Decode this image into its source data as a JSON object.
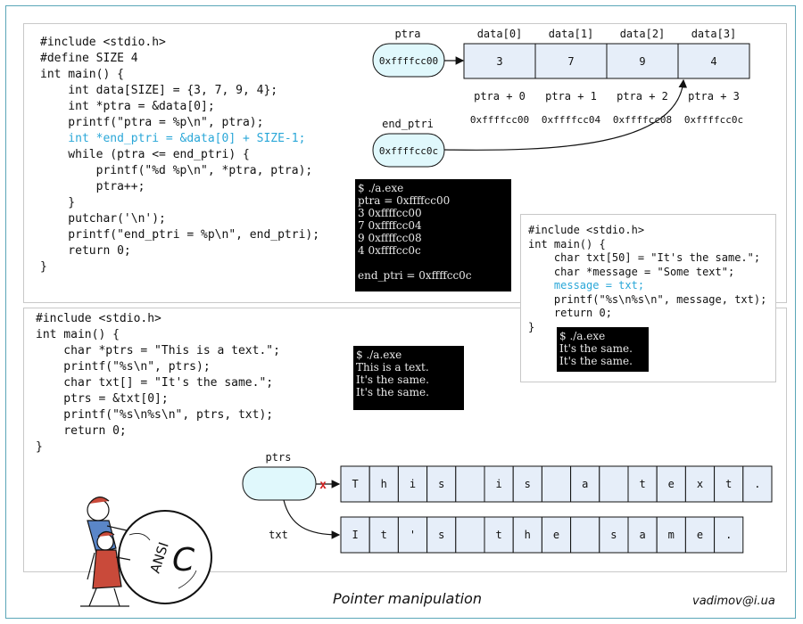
{
  "top_code": {
    "lines": [
      "#include <stdio.h>",
      "#define SIZE 4",
      "int main() {",
      "    int data[SIZE] = {3, 7, 9, 4};",
      "    int *ptra = &data[0];",
      "    printf(\"ptra = %p\\n\", ptra);",
      "    int *end_ptri = &data[0] + SIZE-1;",
      "    while (ptra <= end_ptri) {",
      "        printf(\"%d %p\\n\", *ptra, ptra);",
      "        ptra++;",
      "    }",
      "    putchar('\\n');",
      "    printf(\"end_ptri = %p\\n\", end_ptri);",
      "    return 0;",
      "}"
    ],
    "highlight_line": 6
  },
  "top_terminal": {
    "lines": [
      "$ ./a.exe",
      "ptra = 0xffffcc00",
      "3 0xffffcc00",
      "7 0xffffcc04",
      "9 0xffffcc08",
      "4 0xffffcc0c",
      "",
      "end_ptri = 0xffffcc0c"
    ]
  },
  "array_diagram": {
    "ptra_label": "ptra",
    "ptra_value": "0xffffcc00",
    "end_ptri_label": "end_ptri",
    "end_ptri_value": "0xffffcc0c",
    "headers": [
      "data[0]",
      "data[1]",
      "data[2]",
      "data[3]"
    ],
    "values": [
      "3",
      "7",
      "9",
      "4"
    ],
    "offsets": [
      "ptra + 0",
      "ptra + 1",
      "ptra + 2",
      "ptra + 3"
    ],
    "addresses": [
      "0xffffcc00",
      "0xffffcc04",
      "0xffffcc08",
      "0xffffcc0c"
    ]
  },
  "right_code": {
    "lines": [
      "#include <stdio.h>",
      "int main() {",
      "    char txt[50] = \"It's the same.\";",
      "    char *message = \"Some text\";",
      "    message = txt;",
      "    printf(\"%s\\n%s\\n\", message, txt);",
      "    return 0;",
      "}"
    ],
    "highlight_line": 4
  },
  "right_terminal": {
    "lines": [
      "$ ./a.exe",
      "It's the same.",
      "It's the same."
    ]
  },
  "bottom_code": {
    "lines": [
      "#include <stdio.h>",
      "int main() {",
      "    char *ptrs = \"This is a text.\";",
      "    printf(\"%s\\n\", ptrs);",
      "    char txt[] = \"It's the same.\";",
      "    ptrs = &txt[0];",
      "    printf(\"%s\\n%s\\n\", ptrs, txt);",
      "    return 0;",
      "}"
    ]
  },
  "bottom_terminal": {
    "lines": [
      "$ ./a.exe",
      "This is a text.",
      "It's the same.",
      "It's the same."
    ]
  },
  "string_diagram": {
    "ptrs_label": "ptrs",
    "txt_label": "txt",
    "cut_mark": "x",
    "row1": [
      "T",
      "h",
      "i",
      "s",
      "",
      "i",
      "s",
      "",
      "a",
      "",
      "t",
      "e",
      "x",
      "t",
      "."
    ],
    "row2": [
      "I",
      "t",
      "'",
      "s",
      "",
      "t",
      "h",
      "e",
      "",
      "s",
      "a",
      "m",
      "e",
      "."
    ]
  },
  "logo": {
    "text": "ANSI",
    "letter": "C"
  },
  "footer": {
    "caption": "Pointer manipulation",
    "email": "vadimov@i.ua"
  },
  "colors": {
    "highlight": "#2aa7d8",
    "pointer_fill": "#e0f8fc",
    "cell_fill": "#e6eef9",
    "frame": "#5aa6b8",
    "cut_mark": "#d02020"
  }
}
